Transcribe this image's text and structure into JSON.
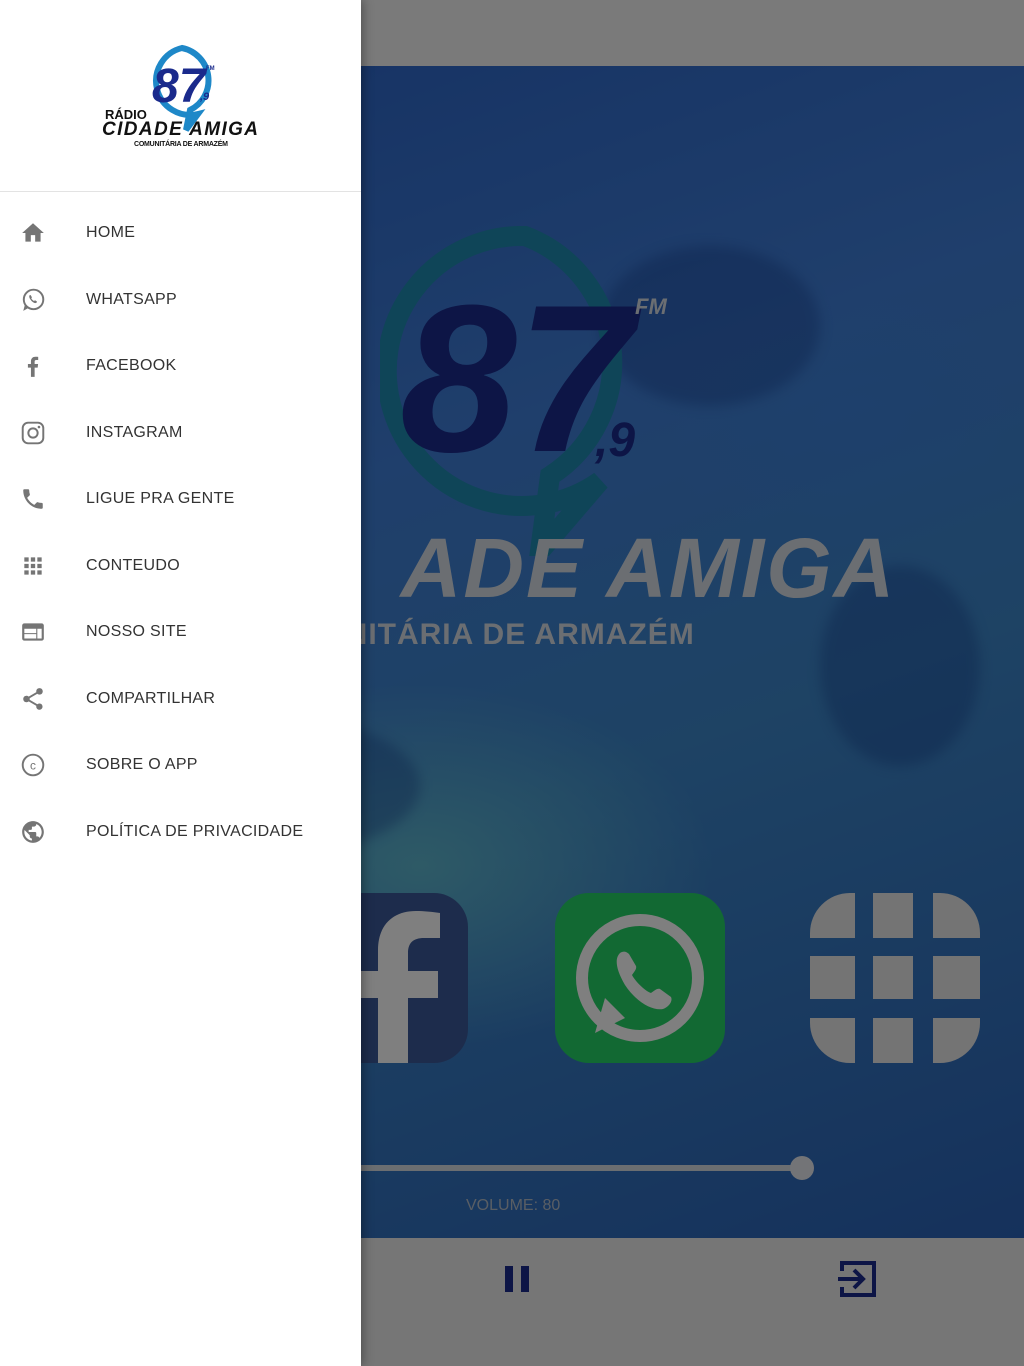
{
  "drawer": {
    "logo": {
      "number": "87",
      "fm": "FM",
      "decimal": ",9",
      "line1": "RÁDIO",
      "line2": "CIDADE AMIGA",
      "line3": "COMUNITÁRIA DE ARMAZÉM"
    },
    "items": [
      {
        "label": "HOME",
        "icon": "home-icon"
      },
      {
        "label": "WHATSAPP",
        "icon": "whatsapp-icon"
      },
      {
        "label": "FACEBOOK",
        "icon": "facebook-icon"
      },
      {
        "label": "INSTAGRAM",
        "icon": "instagram-icon"
      },
      {
        "label": "LIGUE PRA GENTE",
        "icon": "phone-icon"
      },
      {
        "label": "CONTEUDO",
        "icon": "apps-grid-icon"
      },
      {
        "label": "NOSSO SITE",
        "icon": "web-icon"
      },
      {
        "label": "COMPARTILHAR",
        "icon": "share-icon"
      },
      {
        "label": "SOBRE O APP",
        "icon": "copyright-icon"
      },
      {
        "label": "POLÍTICA DE PRIVACIDADE",
        "icon": "globe-icon"
      }
    ],
    "icon_color": "#757575"
  },
  "background": {
    "title_visible": "ADE AMIGA",
    "subtitle_visible": "MUNITÁRIA DE ARMAZÉM",
    "logo_partial_letter": "O",
    "volume_label": "VOLUME: 80",
    "volume_value": 80,
    "shortcuts": [
      "facebook-icon",
      "whatsapp-icon",
      "apps-grid-icon"
    ],
    "player_buttons": [
      "pause-icon",
      "exit-icon"
    ],
    "accent_color": "#1a2a8c"
  }
}
